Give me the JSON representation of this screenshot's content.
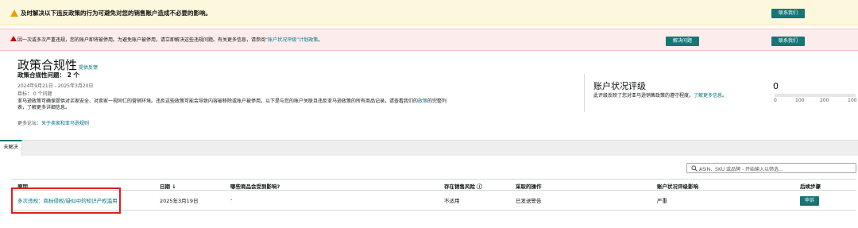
{
  "banners": {
    "warning": {
      "text": "及时解决以下违反政策的行为可避免对您的销售账户造成不必要的影响。",
      "button": "联系我们"
    },
    "error": {
      "text": "因一次或多次严重违规，您的账户即将被停用。为避免账户被停用，请立即解决这些违规问题。有关更多信息，请参阅",
      "link": "“账户状况评级”计划政策",
      "text_end": "。",
      "resolve_button": "解决问题",
      "contact_button": "联系我们"
    }
  },
  "header": {
    "title": "政策合规性",
    "feedback_link": "提供反馈",
    "issue_count": "政策合规性问题： 2 个",
    "date_range": "2024年9月21日 - 2025年3月20日",
    "resolved": "目标： 0 个问题",
    "description": "亚马逊政策可确保提供对买家安全、对卖家一视同仁的营销环境。违反这些政策可能会导致内容被移除或账户被停用。以下是与您的账户关联且违反亚马逊政策的所有商品记录。请查看我们的",
    "description_link": "政策",
    "description_end": "的完整列表，了解更多详细信息。",
    "see_also_label": "更多论坛：",
    "see_also_link": "关于卖家和亚马逊规则"
  },
  "ahr": {
    "title": "账户状况评级",
    "description": "此评级反映了您对亚马逊销售政策的遵守程度。",
    "link": "了解更多信息",
    "link_tail": "。",
    "score": 0,
    "scale_labels": [
      "0",
      "100",
      "200",
      "100"
    ]
  },
  "tabs": [
    {
      "label": "未解决"
    }
  ],
  "search": {
    "placeholder": "ASIN、SKU 或品牌 - 开始输入以筛选..."
  },
  "table": {
    "headers": {
      "reason": "原因",
      "date": "日期 ↓",
      "affected": "哪些商品会受到影响?",
      "sales_risk": "存在销售风险 ⓘ",
      "action": "采取的操作",
      "ahr_impact": "账户状况评级影响",
      "next_steps": "后续步骤"
    },
    "rows": [
      {
        "reason_prefix": "多次违规：",
        "reason_link": "商标侵权/疑似中的知识产权滥用",
        "date": "2025年3月19日",
        "affected": "-",
        "sales_risk": "不适用",
        "action": "已发送警告",
        "ahr_impact": "严重",
        "next_step_button": "申诉"
      }
    ]
  },
  "colors": {
    "accent": "#177575",
    "warning_bg": "#fdf8dd",
    "error_bg": "#fdecec",
    "highlight": "#e0201b"
  }
}
